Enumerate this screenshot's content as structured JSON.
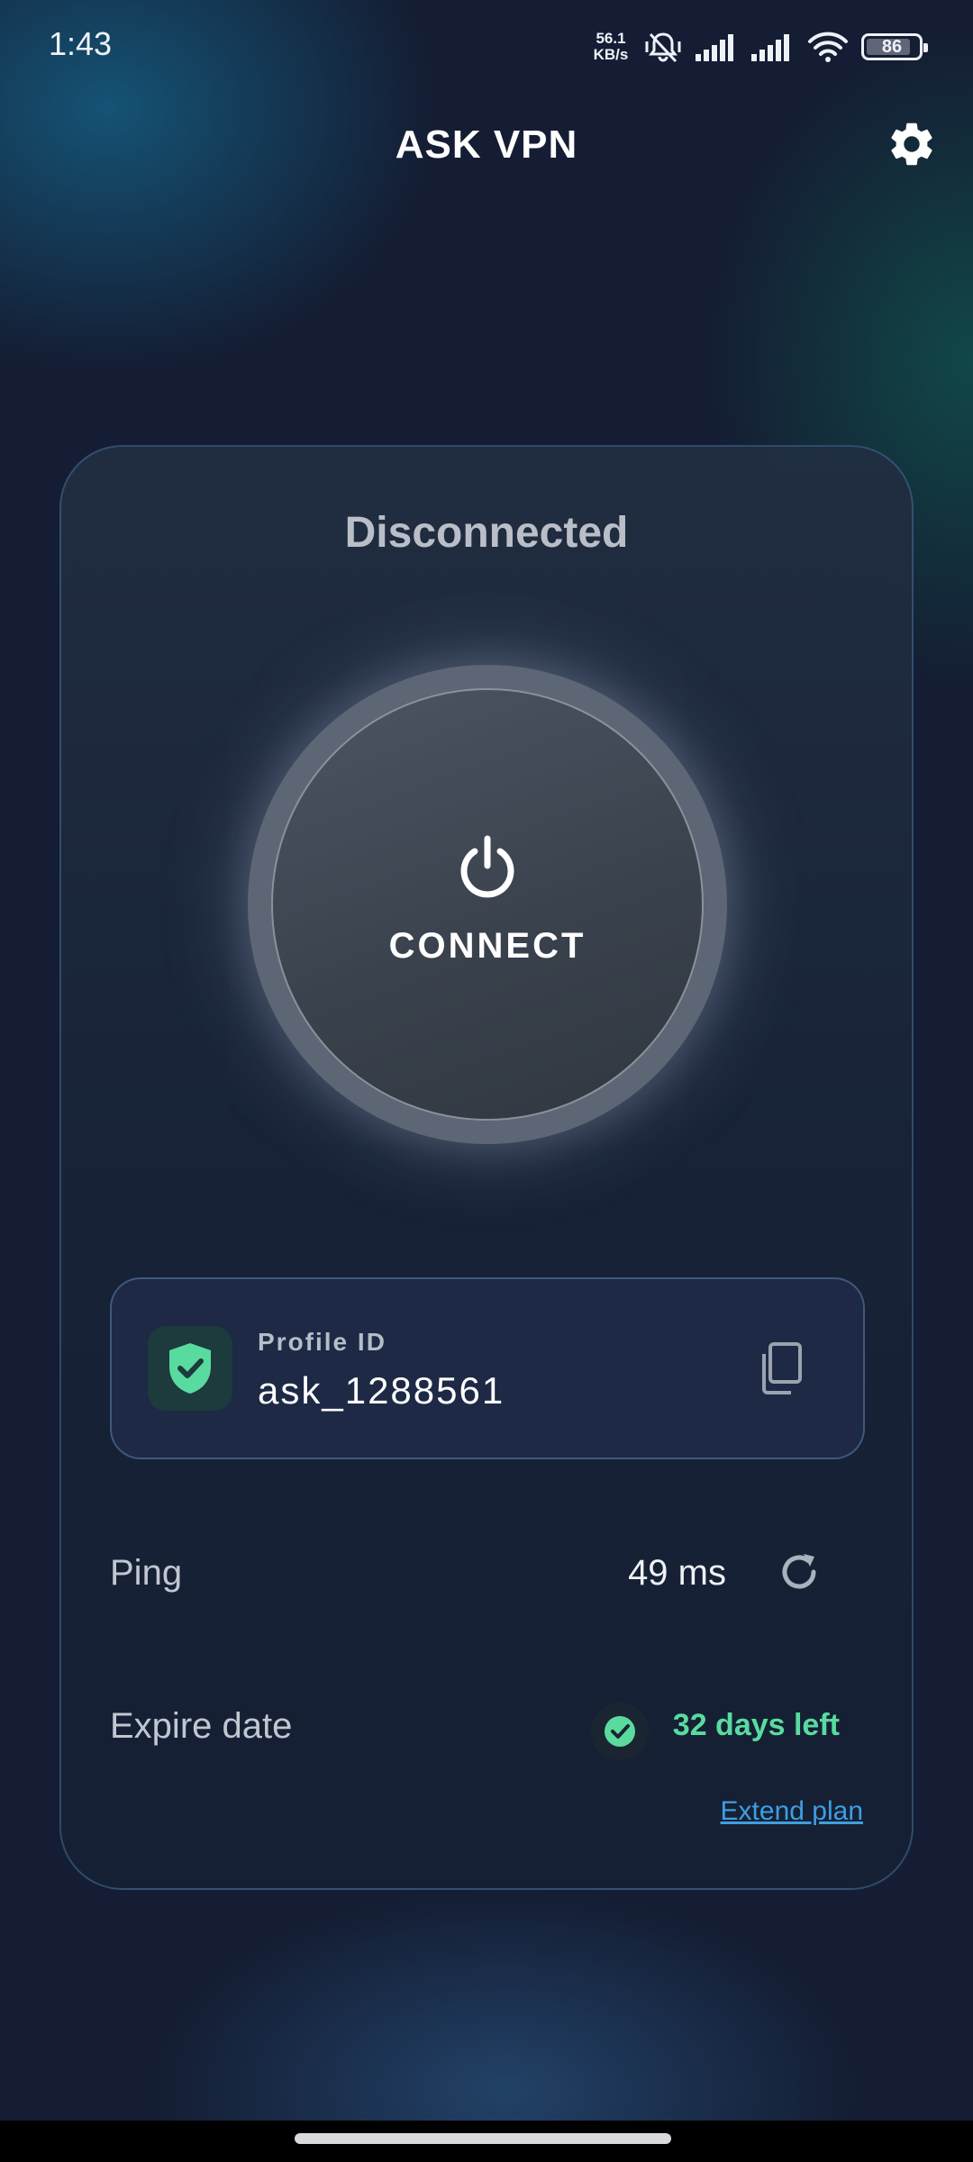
{
  "status_bar": {
    "time": "1:43",
    "net_speed_value": "56.1",
    "net_speed_unit": "KB/s",
    "battery": "86",
    "battery_level": 0.86
  },
  "header": {
    "title": "ASK VPN"
  },
  "card": {
    "status": "Disconnected",
    "connect_label": "CONNECT",
    "profile": {
      "label": "Profile ID",
      "value": "ask_1288561"
    },
    "ping": {
      "label": "Ping",
      "value": "49 ms"
    },
    "expire": {
      "label": "Expire date",
      "value": "32 days left"
    },
    "extend_label": "Extend plan"
  },
  "colors": {
    "accent_green": "#59dba0",
    "link_blue": "#3e9ee0",
    "background": "#141d33"
  },
  "icons": {
    "settings": "gear-icon",
    "power": "power-icon",
    "shield": "shield-check-icon",
    "copy": "copy-icon",
    "refresh": "refresh-icon",
    "check": "check-circle-icon"
  }
}
